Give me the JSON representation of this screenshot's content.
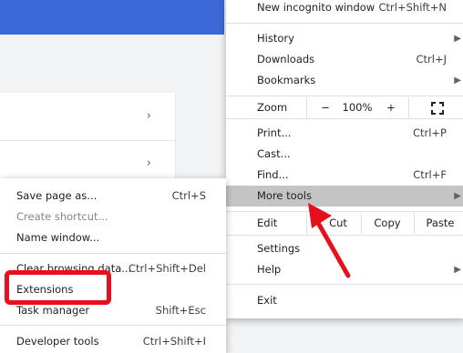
{
  "main_menu": {
    "new_incognito": {
      "label": "New incognito window",
      "shortcut": "Ctrl+Shift+N"
    },
    "history": "History",
    "downloads": {
      "label": "Downloads",
      "shortcut": "Ctrl+J"
    },
    "bookmarks": "Bookmarks",
    "zoom": {
      "label": "Zoom",
      "minus": "−",
      "value": "100%",
      "plus": "+"
    },
    "print": {
      "label": "Print...",
      "shortcut": "Ctrl+P"
    },
    "cast": "Cast...",
    "find": {
      "label": "Find...",
      "shortcut": "Ctrl+F"
    },
    "more_tools": "More tools",
    "edit": {
      "label": "Edit",
      "cut": "Cut",
      "copy": "Copy",
      "paste": "Paste"
    },
    "settings": "Settings",
    "help": "Help",
    "exit": "Exit"
  },
  "sub_menu": {
    "save_page": {
      "label": "Save page as...",
      "shortcut": "Ctrl+S"
    },
    "create_shortcut": "Create shortcut...",
    "name_window": "Name window...",
    "clear_browsing": {
      "label": "Clear browsing data...",
      "shortcut": "Ctrl+Shift+Del"
    },
    "extensions": "Extensions",
    "task_manager": {
      "label": "Task manager",
      "shortcut": "Shift+Esc"
    },
    "developer_tools": {
      "label": "Developer tools",
      "shortcut": "Ctrl+Shift+I"
    }
  },
  "colors": {
    "highlight": "#c4c4c4",
    "annotation_red": "#e5101b",
    "header_blue": "#3c68d8"
  }
}
